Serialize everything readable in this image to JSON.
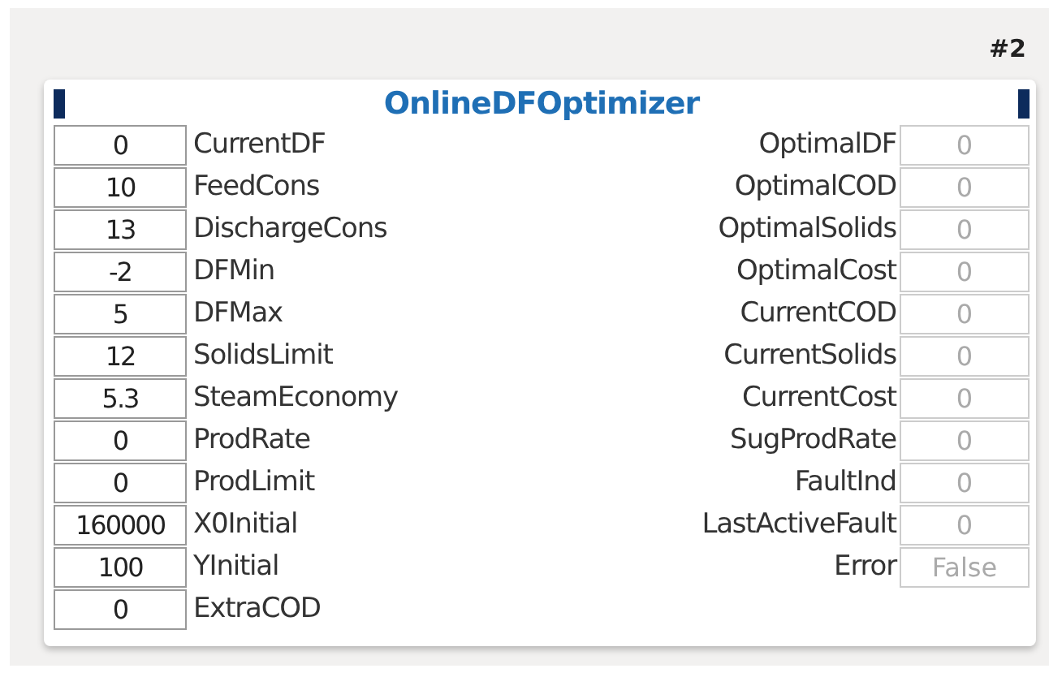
{
  "block_number": "#2",
  "block": {
    "title": "OnlineDFOptimizer",
    "inputs": [
      {
        "name": "CurrentDF",
        "value": "0"
      },
      {
        "name": "FeedCons",
        "value": "10"
      },
      {
        "name": "DischargeCons",
        "value": "13"
      },
      {
        "name": "DFMin",
        "value": "-2"
      },
      {
        "name": "DFMax",
        "value": "5"
      },
      {
        "name": "SolidsLimit",
        "value": "12"
      },
      {
        "name": "SteamEconomy",
        "value": "5.3"
      },
      {
        "name": "ProdRate",
        "value": "0"
      },
      {
        "name": "ProdLimit",
        "value": "0"
      },
      {
        "name": "X0Initial",
        "value": "160000"
      },
      {
        "name": "YInitial",
        "value": "100"
      },
      {
        "name": "ExtraCOD",
        "value": "0"
      }
    ],
    "outputs": [
      {
        "name": "OptimalDF",
        "value": "0"
      },
      {
        "name": "OptimalCOD",
        "value": "0"
      },
      {
        "name": "OptimalSolids",
        "value": "0"
      },
      {
        "name": "OptimalCost",
        "value": "0"
      },
      {
        "name": "CurrentCOD",
        "value": "0"
      },
      {
        "name": "CurrentSolids",
        "value": "0"
      },
      {
        "name": "CurrentCost",
        "value": "0"
      },
      {
        "name": "SugProdRate",
        "value": "0"
      },
      {
        "name": "FaultInd",
        "value": "0"
      },
      {
        "name": "LastActiveFault",
        "value": "0"
      },
      {
        "name": "Error",
        "value": "False"
      }
    ]
  }
}
